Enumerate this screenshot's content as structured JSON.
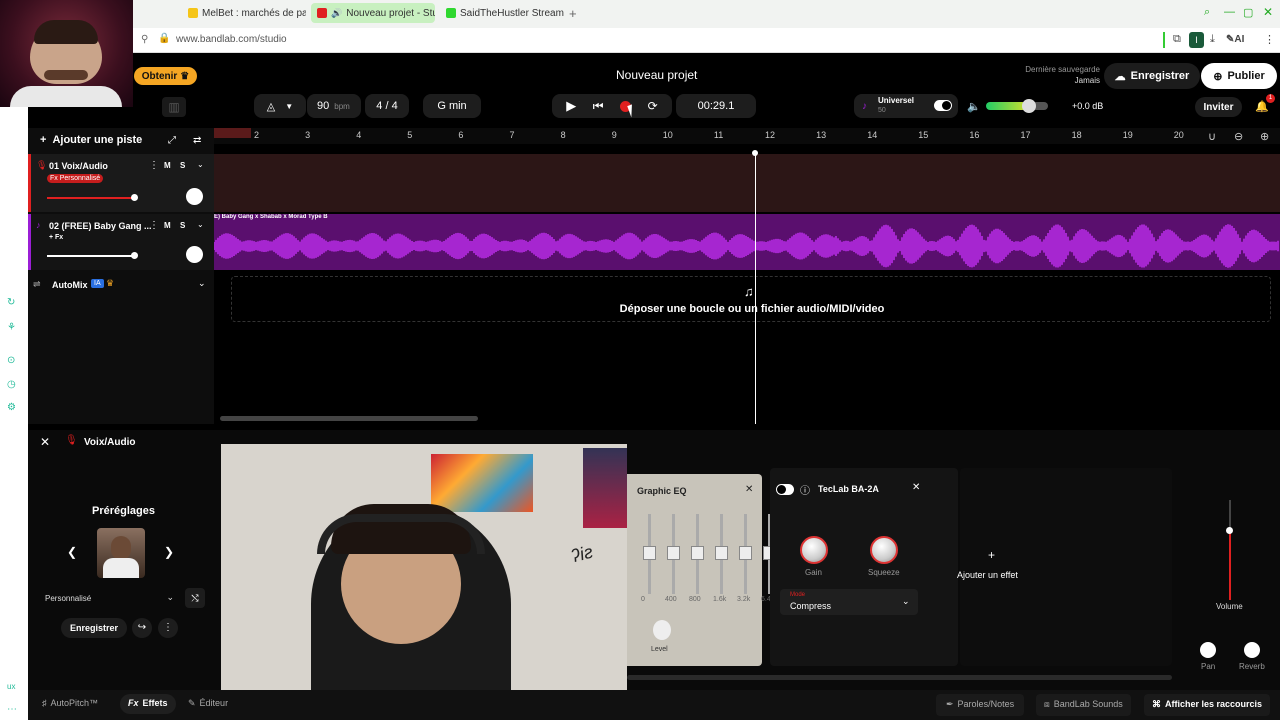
{
  "browser": {
    "tabs": [
      {
        "label": "MelBet : marchés de paris"
      },
      {
        "label": "Nouveau projet - Stud"
      },
      {
        "label": "SaidTheHustler Stream - V"
      }
    ],
    "url": "www.bandlab.com/studio",
    "ext_label": "AI"
  },
  "header": {
    "obtain_label": "Obtenir",
    "project_title": "Nouveau projet",
    "last_save_label": "Dernière sauvegarde",
    "last_save_value": "Jamais",
    "save_button": "Enregistrer",
    "publish_button": "Publier",
    "invite_button": "Inviter",
    "notif_count": "1"
  },
  "toolbar": {
    "bpm_value": "90",
    "bpm_unit": "bpm",
    "time_sig": "4 / 4",
    "key": "G min",
    "timer": "00:29.1",
    "preset_name": "Universel",
    "preset_value": "50",
    "master_db": "+0.0 dB"
  },
  "tracks": {
    "add_track": "Ajouter une piste",
    "track1": {
      "name": "01  Voix/Audio",
      "badge": "Fx Personnalisé",
      "m": "M",
      "s": "S"
    },
    "track2": {
      "name": "02  (FREE) Baby Gang ...",
      "badge": "+ Fx",
      "m": "M",
      "s": "S",
      "clip_label": "E) Baby Gang x Shabab x Morad Type B"
    },
    "automix": {
      "name": "AutoMix",
      "ia": "IA"
    }
  },
  "ruler": [
    "2",
    "3",
    "4",
    "5",
    "6",
    "7",
    "8",
    "9",
    "10",
    "11",
    "12",
    "13",
    "14",
    "15",
    "16",
    "17",
    "18",
    "19",
    "20"
  ],
  "dropzone_text": "Déposer une boucle ou un fichier audio/MIDI/video",
  "panel": {
    "track_name": "Voix/Audio",
    "presets_title": "Préréglages",
    "preset_select": "Personnalisé",
    "save_button": "Enregistrer",
    "eq_title": "Graphic EQ",
    "eq_freqs": [
      "0",
      "400",
      "800",
      "1.6k",
      "3.2k",
      "6.4k"
    ],
    "eq_level": "Level",
    "comp_title": "TecLab BA-2A",
    "gain_label": "Gain",
    "squeeze_label": "Squeeze",
    "mode_label": "Mode",
    "mode_value": "Compress",
    "add_effect": "Ajouter un effet",
    "volume_label": "Volume",
    "pan_label": "Pan",
    "reverb_label": "Reverb"
  },
  "bottom": {
    "autopitch": "AutoPitch™",
    "effects": "Effets",
    "editor": "Éditeur",
    "lyrics": "Paroles/Notes",
    "sounds": "BandLab Sounds",
    "shortcuts": "Afficher les raccourcis"
  },
  "colors": {
    "accent_red": "#e02020",
    "purple": "#9b1fd6",
    "gold": "#f5a623"
  }
}
